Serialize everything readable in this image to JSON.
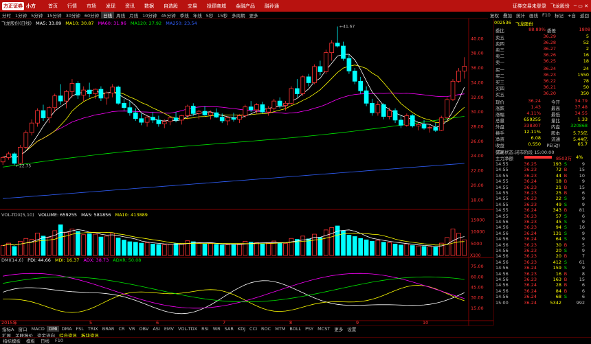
{
  "menubar": {
    "logo_brand": "方正证券",
    "logo_app": "小方",
    "items": [
      "首页",
      "行情",
      "市场",
      "发现",
      "资讯",
      "数据",
      "自选股",
      "交易",
      "投顾商城",
      "金融产品",
      "融孙通"
    ]
  },
  "titlebar": {
    "status": "证券交易未登录",
    "stock": "飞龙股份"
  },
  "periods": [
    "分时",
    "1分钟",
    "5分钟",
    "15分钟",
    "30分钟",
    "60分钟",
    "日线",
    "周线",
    "月线",
    "10分钟",
    "45分钟",
    "季线",
    "年线",
    "5秒",
    "15秒",
    "多周期",
    "更多"
  ],
  "active_period": "日线",
  "toolbar_right": [
    "复权",
    "叠加",
    "统计",
    "画线",
    "F10",
    "标记",
    "+自",
    "返回"
  ],
  "rightbar_labels": [
    "标记",
    "+自",
    "返回"
  ],
  "main_chart": {
    "header": {
      "name": "飞龙股份(日线)",
      "ma5": "MA5: 33.89",
      "ma10": "MA10: 30.87",
      "ma60": "MA60: 31.96",
      "ma120": "MA120: 27.92",
      "ma250": "MA250: 23.54"
    },
    "y_labels": [
      "40.00",
      "38.00",
      "36.00",
      "34.00",
      "32.00",
      "30.00",
      "28.00",
      "26.00",
      "24.00",
      "22.00",
      "20.00",
      "18.00"
    ],
    "high_label": "41.67",
    "low_label": "22.75"
  },
  "vol_chart": {
    "header": {
      "name": "VOL-TDX(5,10)",
      "volume": "VOLUME: 659255",
      "ma5": "MA5: 581856",
      "ma10": "MA10: 413889"
    },
    "y_labels": [
      "15000",
      "10000",
      "5000"
    ],
    "unit": "X100"
  },
  "dmi_chart": {
    "header": {
      "name": "DMI(14,6)",
      "pdi": "PDI: 44.66",
      "mdi": "MDI: 16.37",
      "adx": "ADX: 38.73",
      "adxr": "ADXR: 50.08"
    },
    "y_labels": [
      "75.00",
      "60.00",
      "45.00",
      "30.00",
      "15.00"
    ]
  },
  "x_axis": {
    "year": "2015年",
    "months": [
      "5",
      "6",
      "7",
      "8",
      "9",
      "10"
    ]
  },
  "indicator_bar": [
    "指标A",
    "窗口",
    "MACD",
    "DMI",
    "DMA",
    "FSL",
    "TRIX",
    "BRAR",
    "CR",
    "VR",
    "OBV",
    "ASI",
    "EMV",
    "VOL-TDX",
    "RSI",
    "WR",
    "SAR",
    "KDJ",
    "CCI",
    "ROC",
    "MTM",
    "BOLL",
    "PSY",
    "MCST",
    "更多",
    "设置"
  ],
  "active_indicator": "DMI",
  "tabs2": [
    "扩展",
    "关联报价",
    "资金流向",
    "综合资讯",
    "板块资讯"
  ],
  "status_bar": [
    "指标模板",
    "模板",
    "日线",
    "F10"
  ],
  "quote": {
    "code": "002536",
    "name": "飞龙股份",
    "weibi": {
      "label": "委比",
      "value": "88.89%",
      "label2": "委差",
      "value2": "1808"
    },
    "sells": [
      {
        "label": "卖五",
        "price": "36.29",
        "vol": "5"
      },
      {
        "label": "卖四",
        "price": "36.28",
        "vol": "52"
      },
      {
        "label": "卖三",
        "price": "36.27",
        "vol": "2"
      },
      {
        "label": "卖二",
        "price": "36.26",
        "vol": "16"
      },
      {
        "label": "卖一",
        "price": "36.25",
        "vol": "18"
      }
    ],
    "buys": [
      {
        "label": "买一",
        "price": "36.24",
        "vol": "24"
      },
      {
        "label": "买二",
        "price": "36.23",
        "vol": "1550"
      },
      {
        "label": "买三",
        "price": "36.22",
        "vol": "78"
      },
      {
        "label": "买四",
        "price": "36.21",
        "vol": "50"
      },
      {
        "label": "买五",
        "price": "36.20",
        "vol": "350"
      }
    ],
    "stats": [
      {
        "l1": "现价",
        "v1": "36.24",
        "l2": "今开",
        "v2": "34.79"
      },
      {
        "l1": "涨跌",
        "v1": "1.43",
        "l2": "最高",
        "v2": "37.48"
      },
      {
        "l1": "涨幅",
        "v1": "4.11%",
        "l2": "最低",
        "v2": "34.55"
      },
      {
        "l1": "总量",
        "v1": "659255",
        "l2": "量比",
        "v2": "1.33"
      },
      {
        "l1": "外盘",
        "v1": "338307",
        "l2": "内盘",
        "v2": "320868"
      },
      {
        "l1": "换手",
        "v1": "12.11%",
        "l2": "股本",
        "v2": "5.75亿"
      },
      {
        "l1": "净资",
        "v1": "6.08",
        "l2": "流通",
        "v2": "5.44亿"
      },
      {
        "l1": "收益(四)",
        "v1": "0.550",
        "l2": "PE(动)",
        "v2": "65.7"
      }
    ],
    "trade_status": "交易状态:闭市阶段 15:00:00",
    "net_inflow": {
      "label": "主力净额",
      "value": "8503万",
      "pct": "4%"
    },
    "ticks": [
      {
        "t": "14:55",
        "p": "36.25",
        "v": "193",
        "d": "S",
        "n": "9"
      },
      {
        "t": "14:55",
        "p": "36.23",
        "v": "72",
        "d": "B",
        "n": "15"
      },
      {
        "t": "14:55",
        "p": "36.23",
        "v": "44",
        "d": "B",
        "n": "10"
      },
      {
        "t": "14:55",
        "p": "36.24",
        "v": "18",
        "d": "B",
        "n": "9"
      },
      {
        "t": "14:55",
        "p": "36.23",
        "v": "21",
        "d": "B",
        "n": "15"
      },
      {
        "t": "14:55",
        "p": "36.23",
        "v": "25",
        "d": "B",
        "n": "6"
      },
      {
        "t": "14:55",
        "p": "36.23",
        "v": "22",
        "d": "S",
        "n": "9"
      },
      {
        "t": "14:55",
        "p": "36.23",
        "v": "49",
        "d": "S",
        "n": "9"
      },
      {
        "t": "14:55",
        "p": "36.24",
        "v": "343",
        "d": "B",
        "n": "81"
      },
      {
        "t": "14:55",
        "p": "36.23",
        "v": "57",
        "d": "S",
        "n": "6"
      },
      {
        "t": "14:56",
        "p": "36.23",
        "v": "45",
        "d": "S",
        "n": "9"
      },
      {
        "t": "14:56",
        "p": "36.23",
        "v": "94",
        "d": "S",
        "n": "16"
      },
      {
        "t": "14:56",
        "p": "36.24",
        "v": "131",
        "d": "S",
        "n": "9"
      },
      {
        "t": "14:56",
        "p": "36.24",
        "v": "64",
        "d": "S",
        "n": "9"
      },
      {
        "t": "14:56",
        "p": "36.23",
        "v": "30",
        "d": "B",
        "n": "5"
      },
      {
        "t": "14:56",
        "p": "36.23",
        "v": "20",
        "d": "S",
        "n": "9"
      },
      {
        "t": "14:56",
        "p": "36.23",
        "v": "20",
        "d": "B",
        "n": "7"
      },
      {
        "t": "14:56",
        "p": "36.23",
        "v": "412",
        "d": "S",
        "n": "61"
      },
      {
        "t": "14:56",
        "p": "36.24",
        "v": "159",
        "d": "S",
        "n": "9"
      },
      {
        "t": "14:56",
        "p": "36.23",
        "v": "16",
        "d": "B",
        "n": "8"
      },
      {
        "t": "14:56",
        "p": "36.23",
        "v": "163",
        "d": "B",
        "n": "15"
      },
      {
        "t": "14:56",
        "p": "36.24",
        "v": "28",
        "d": "B",
        "n": "6"
      },
      {
        "t": "14:56",
        "p": "36.24",
        "v": "84",
        "d": "B",
        "n": "6"
      },
      {
        "t": "14:56",
        "p": "36.24",
        "v": "68",
        "d": "S",
        "n": "6"
      },
      {
        "t": "15:00",
        "p": "36.24",
        "v": "5342",
        "d": "",
        "n": "992"
      }
    ],
    "bottom_tabs": [
      "日线",
      "指标模板",
      "模板",
      "分时"
    ]
  },
  "chart_data": {
    "type": "candlestick",
    "colors": {
      "up": "#ff3232",
      "down": "#00ffff",
      "ma5": "#ffffff",
      "ma10": "#ffff00",
      "ma60": "#ff00ff",
      "ma120": "#00e600",
      "ma250": "#3060ff"
    },
    "candles": [
      [
        23.2,
        24.0,
        22.8,
        23.8
      ],
      [
        23.8,
        24.6,
        23.5,
        24.3
      ],
      [
        24.3,
        24.5,
        22.75,
        23.0
      ],
      [
        23.0,
        25.5,
        22.9,
        25.2
      ],
      [
        25.2,
        27.5,
        25.0,
        27.2
      ],
      [
        27.2,
        29.0,
        26.8,
        28.5
      ],
      [
        28.5,
        30.5,
        28.0,
        30.2
      ],
      [
        30.2,
        31.0,
        28.8,
        29.2
      ],
      [
        29.2,
        30.8,
        28.5,
        30.6
      ],
      [
        30.6,
        32.5,
        30.0,
        32.2
      ],
      [
        32.2,
        33.8,
        31.0,
        31.5
      ],
      [
        31.5,
        33.0,
        30.5,
        32.8
      ],
      [
        32.8,
        34.5,
        32.0,
        33.9
      ],
      [
        33.9,
        34.2,
        31.8,
        32.3
      ],
      [
        32.3,
        33.5,
        31.5,
        33.0
      ],
      [
        33.0,
        34.0,
        32.0,
        32.5
      ],
      [
        32.5,
        33.2,
        31.8,
        33.1
      ],
      [
        33.1,
        33.5,
        31.5,
        31.9
      ],
      [
        31.9,
        32.8,
        31.0,
        32.6
      ],
      [
        32.6,
        33.8,
        32.0,
        33.4
      ],
      [
        33.4,
        33.6,
        31.0,
        31.2
      ],
      [
        31.2,
        31.8,
        30.2,
        30.6
      ],
      [
        30.6,
        31.5,
        29.5,
        29.9
      ],
      [
        29.9,
        30.5,
        28.8,
        29.1
      ],
      [
        29.1,
        29.8,
        28.2,
        28.6
      ],
      [
        28.6,
        29.5,
        28.0,
        29.3
      ],
      [
        29.3,
        30.0,
        28.5,
        28.9
      ],
      [
        28.9,
        29.5,
        28.0,
        28.4
      ],
      [
        28.4,
        29.0,
        27.8,
        28.7
      ],
      [
        28.7,
        29.4,
        28.2,
        29.2
      ],
      [
        29.2,
        30.0,
        28.6,
        28.9
      ],
      [
        28.9,
        29.6,
        28.3,
        29.5
      ],
      [
        29.5,
        31.0,
        29.0,
        30.8
      ],
      [
        30.8,
        31.2,
        29.5,
        29.8
      ],
      [
        29.8,
        30.3,
        29.0,
        30.1
      ],
      [
        30.1,
        30.8,
        29.5,
        29.6
      ],
      [
        29.6,
        30.2,
        29.0,
        29.9
      ],
      [
        29.9,
        30.5,
        29.2,
        29.3
      ],
      [
        29.3,
        29.8,
        28.5,
        28.8
      ],
      [
        28.8,
        29.4,
        28.2,
        29.2
      ],
      [
        29.2,
        29.9,
        28.7,
        29.0
      ],
      [
        29.0,
        29.7,
        28.5,
        29.5
      ],
      [
        29.5,
        31.0,
        29.2,
        30.7
      ],
      [
        30.7,
        31.5,
        30.0,
        30.3
      ],
      [
        30.3,
        31.2,
        29.8,
        31.0
      ],
      [
        31.0,
        31.4,
        29.8,
        30.0
      ],
      [
        30.0,
        30.8,
        29.5,
        30.5
      ],
      [
        30.5,
        31.8,
        30.2,
        31.5
      ],
      [
        31.5,
        32.0,
        30.5,
        30.9
      ],
      [
        30.9,
        31.5,
        30.2,
        31.2
      ],
      [
        31.2,
        33.5,
        31.0,
        33.2
      ],
      [
        33.2,
        34.5,
        32.0,
        32.5
      ],
      [
        32.5,
        35.0,
        32.2,
        34.8
      ],
      [
        34.8,
        35.2,
        33.5,
        34.0
      ],
      [
        34.0,
        36.5,
        33.8,
        36.2
      ],
      [
        36.2,
        37.0,
        35.0,
        35.5
      ],
      [
        35.5,
        38.5,
        35.2,
        38.1
      ],
      [
        38.1,
        39.8,
        37.0,
        39.4
      ],
      [
        39.4,
        41.67,
        38.8,
        39.0
      ],
      [
        39.0,
        39.6,
        37.0,
        37.3
      ],
      [
        37.3,
        37.8,
        35.2,
        35.6
      ],
      [
        35.6,
        36.0,
        33.8,
        34.2
      ],
      [
        34.2,
        34.8,
        32.5,
        32.9
      ],
      [
        32.9,
        33.5,
        30.8,
        31.2
      ],
      [
        31.2,
        31.8,
        29.5,
        29.9
      ],
      [
        29.9,
        31.5,
        29.5,
        31.0
      ],
      [
        31.0,
        31.2,
        29.0,
        29.4
      ],
      [
        29.4,
        30.6,
        29.0,
        30.2
      ],
      [
        30.2,
        30.5,
        28.5,
        28.9
      ],
      [
        28.9,
        29.5,
        27.8,
        28.2
      ],
      [
        28.2,
        29.8,
        28.0,
        29.5
      ],
      [
        29.5,
        29.7,
        27.9,
        28.1
      ],
      [
        28.1,
        28.6,
        27.5,
        28.3
      ],
      [
        28.3,
        28.9,
        27.6,
        27.8
      ],
      [
        27.8,
        28.2,
        27.2,
        27.9
      ],
      [
        27.9,
        28.5,
        27.3,
        27.5
      ],
      [
        27.5,
        29.5,
        27.4,
        29.2
      ],
      [
        29.2,
        32.0,
        29.0,
        31.7
      ],
      [
        31.7,
        34.5,
        31.5,
        34.2
      ],
      [
        34.2,
        36.0,
        34.0,
        35.6
      ],
      [
        35.6,
        37.48,
        34.55,
        36.24
      ]
    ],
    "volume": [
      4200,
      5200,
      3800,
      6000,
      7200,
      6800,
      9500,
      8200,
      7600,
      10500,
      13000,
      9800,
      11200,
      10200,
      8800,
      9200,
      9000,
      7800,
      8200,
      9500,
      7400,
      6500,
      5800,
      5600,
      5200,
      5400,
      4800,
      4600,
      4500,
      4700,
      5000,
      4800,
      6200,
      5800,
      5200,
      4900,
      5100,
      4700,
      4400,
      4500,
      4600,
      4800,
      6000,
      5600,
      5400,
      5000,
      5200,
      6100,
      5400,
      5100,
      7200,
      6800,
      8200,
      7000,
      9000,
      7600,
      10800,
      11800,
      12500,
      10400,
      8600,
      8000,
      7200,
      6600,
      6000,
      6400,
      5600,
      5400,
      4800,
      4400,
      4900,
      4200,
      4000,
      3800,
      3600,
      3500,
      5200,
      7600,
      11200,
      9400,
      6592
    ]
  }
}
